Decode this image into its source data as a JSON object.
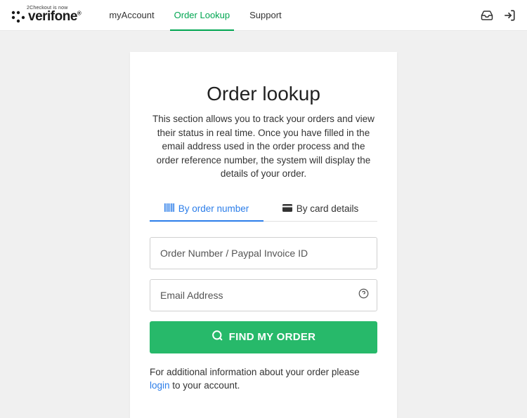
{
  "header": {
    "tagline": "2Checkout is now",
    "brand": "verifone",
    "nav": {
      "my_account": "myAccount",
      "order_lookup": "Order Lookup",
      "support": "Support"
    }
  },
  "card": {
    "title": "Order lookup",
    "subtitle": "This section allows you to track your orders and view their status in real time. Once you have filled in the email address used in the order process and the order reference number, the system will display the details of your order.",
    "tabs": {
      "by_order": "By order number",
      "by_card": "By card details"
    },
    "inputs": {
      "order_placeholder": "Order Number / Paypal Invoice ID",
      "email_placeholder": "Email Address"
    },
    "button": "FIND MY ORDER",
    "footer_pre": "For additional information about your order please ",
    "footer_link": "login",
    "footer_post": " to your account."
  }
}
